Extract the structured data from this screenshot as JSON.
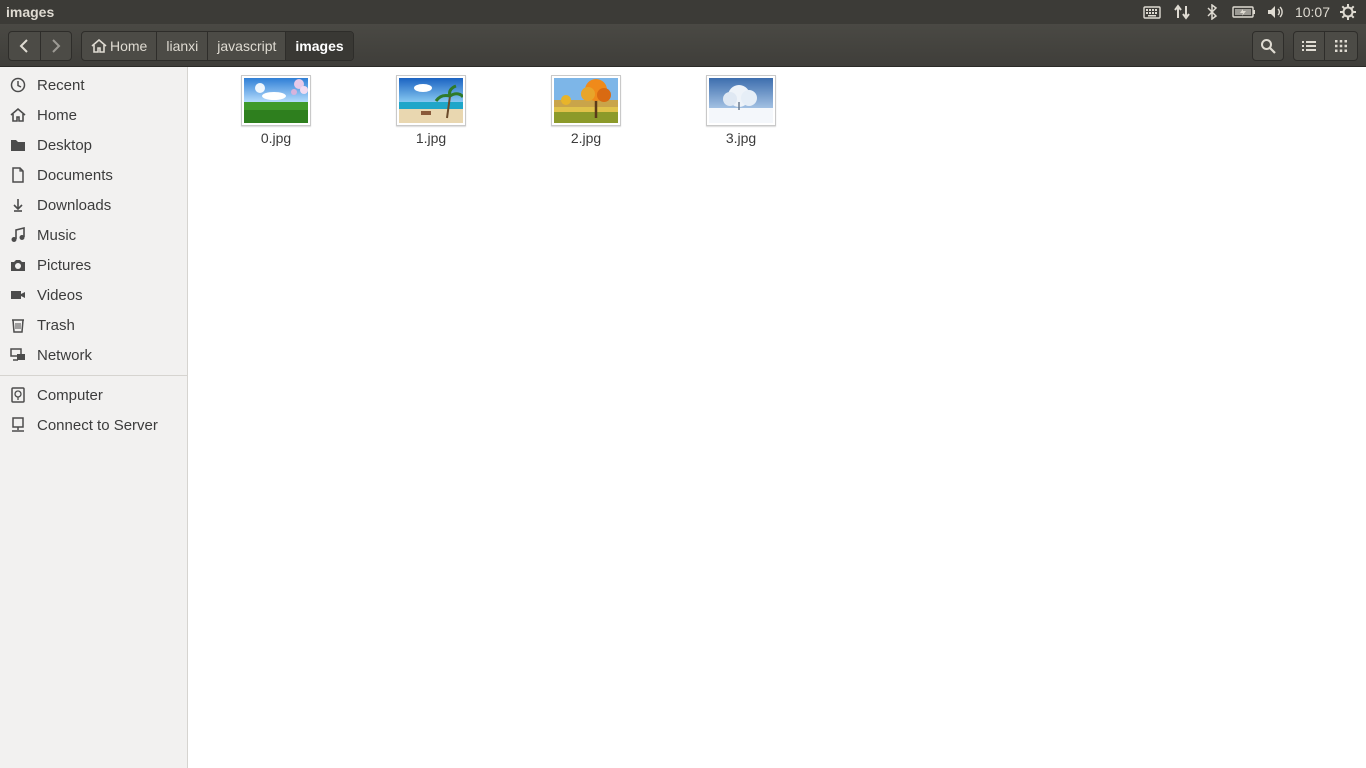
{
  "window": {
    "title": "images"
  },
  "panel": {
    "clock": "10:07"
  },
  "toolbar": {
    "breadcrumbs": [
      "Home",
      "lianxi",
      "javascript",
      "images"
    ]
  },
  "sidebar": {
    "places": [
      {
        "label": "Recent",
        "icon": "clock-icon"
      },
      {
        "label": "Home",
        "icon": "home-icon"
      },
      {
        "label": "Desktop",
        "icon": "folder-icon"
      },
      {
        "label": "Documents",
        "icon": "document-icon"
      },
      {
        "label": "Downloads",
        "icon": "download-icon"
      },
      {
        "label": "Music",
        "icon": "music-icon"
      },
      {
        "label": "Pictures",
        "icon": "camera-icon"
      },
      {
        "label": "Videos",
        "icon": "video-icon"
      },
      {
        "label": "Trash",
        "icon": "trash-icon"
      },
      {
        "label": "Network",
        "icon": "network-icon"
      }
    ],
    "devices": [
      {
        "label": "Computer",
        "icon": "computer-icon"
      },
      {
        "label": "Connect to Server",
        "icon": "server-icon"
      }
    ]
  },
  "files": [
    {
      "name": "0.jpg",
      "thumb": "meadow"
    },
    {
      "name": "1.jpg",
      "thumb": "beach"
    },
    {
      "name": "2.jpg",
      "thumb": "autumn"
    },
    {
      "name": "3.jpg",
      "thumb": "winter"
    }
  ]
}
